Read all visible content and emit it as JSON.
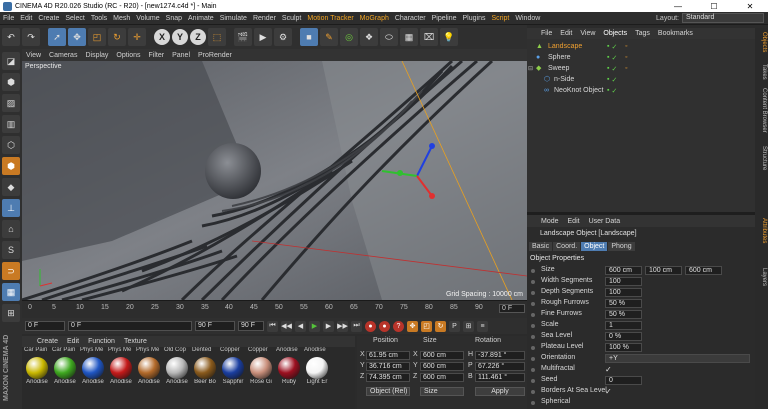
{
  "window": {
    "title": "CINEMA 4D R20.026 Studio (RC - R20) - [new1274.c4d *] - Main",
    "minimize": "—",
    "maximize": "☐",
    "close": "✕"
  },
  "menubar": {
    "items": [
      "File",
      "Edit",
      "Create",
      "Select",
      "Tools",
      "Mesh",
      "Volume",
      "Snap",
      "Animate",
      "Simulate",
      "Render",
      "Sculpt",
      "Motion Tracker",
      "MoGraph",
      "Character",
      "Pipeline",
      "Plugins",
      "Script",
      "Window"
    ],
    "layout_label": "Layout:",
    "layout_value": "Standard"
  },
  "viewport": {
    "menu": [
      "View",
      "Cameras",
      "Display",
      "Options",
      "Filter",
      "Panel",
      "ProRender"
    ],
    "camera_label": "Perspective",
    "grid_spacing": "Grid Spacing : 10000 cm"
  },
  "timeline": {
    "ticks": [
      "0",
      "5",
      "10",
      "15",
      "20",
      "25",
      "30",
      "35",
      "40",
      "45",
      "50",
      "55",
      "60",
      "65",
      "70",
      "75",
      "80",
      "85",
      "90"
    ],
    "end_field": "0 F",
    "current": "0 F",
    "start": "0 F",
    "range_end": "90 F",
    "max": "90 F"
  },
  "material_manager": {
    "menu": [
      "Create",
      "Edit",
      "Function",
      "Texture"
    ],
    "top_labels": [
      "Car Pain",
      "Car Pain",
      "Phys Me",
      "Phys Me",
      "Phys Me",
      "Old Cop",
      "Dented",
      "Copper",
      "Copper",
      "Anodise",
      "Anodise"
    ],
    "materials": [
      {
        "label": "Anodise",
        "color": "#c9b800"
      },
      {
        "label": "Anodise",
        "color": "#3ea81f"
      },
      {
        "label": "Anodise",
        "color": "#1f56c4"
      },
      {
        "label": "Anodise",
        "color": "#c41a1a"
      },
      {
        "label": "Anodise",
        "color": "#b36a2a"
      },
      {
        "label": "Anodise",
        "color": "#b8b8b8"
      },
      {
        "label": "Beer Bo",
        "color": "#8a5a1c"
      },
      {
        "label": "Sapphir",
        "color": "#1a3ea0"
      },
      {
        "label": "Rose Gi",
        "color": "#c98f7b"
      },
      {
        "label": "Ruby",
        "color": "#9c1020"
      },
      {
        "label": "Light Er",
        "color": "#f4f4f4"
      }
    ]
  },
  "coordinates": {
    "headers": [
      "Position",
      "Size",
      "Rotation"
    ],
    "rows": [
      {
        "axis": "X",
        "pos": "61.95 cm",
        "saxis": "X",
        "size": "600 cm",
        "raxis": "H",
        "rot": "-37.891 °"
      },
      {
        "axis": "Y",
        "pos": "36.716 cm",
        "saxis": "Y",
        "size": "600 cm",
        "raxis": "P",
        "rot": "67.226 °"
      },
      {
        "axis": "Z",
        "pos": "74.395 cm",
        "saxis": "Z",
        "size": "600 cm",
        "raxis": "B",
        "rot": "111.461 °"
      }
    ],
    "mode": "Object (Rel)",
    "size_mode": "Size",
    "apply": "Apply"
  },
  "object_manager": {
    "menu": [
      "File",
      "Edit",
      "View",
      "Objects",
      "Tags",
      "Bookmarks"
    ],
    "objects": [
      {
        "name": "Landscape",
        "selected": true,
        "icon": "landscape-icon",
        "glyph": "▲"
      },
      {
        "name": "Sphere",
        "selected": false,
        "icon": "sphere-icon",
        "glyph": "●"
      },
      {
        "name": "Sweep",
        "selected": false,
        "icon": "sweep-icon",
        "glyph": "◆"
      },
      {
        "name": "n-Side",
        "selected": false,
        "icon": "nside-icon",
        "glyph": "⬡"
      },
      {
        "name": "NeoKnot Object",
        "selected": false,
        "icon": "knot-icon",
        "glyph": "∞"
      }
    ]
  },
  "attribute_manager": {
    "menu": [
      "Mode",
      "Edit",
      "User Data"
    ],
    "title": "Landscape Object [Landscape]",
    "tabs": [
      "Basic",
      "Coord.",
      "Object",
      "Phong"
    ],
    "active_tab": "Object",
    "section": "Object Properties",
    "rows": [
      {
        "label": "Size",
        "values": [
          "600 cm",
          "100 cm",
          "600 cm"
        ]
      },
      {
        "label": "Width Segments",
        "values": [
          "100"
        ]
      },
      {
        "label": "Depth Segments",
        "values": [
          "100"
        ]
      },
      {
        "label": "Rough Furrows",
        "values": [
          "50 %"
        ]
      },
      {
        "label": "Fine Furrows",
        "values": [
          "50 %"
        ]
      },
      {
        "label": "Scale",
        "values": [
          "1"
        ]
      },
      {
        "label": "Sea Level",
        "values": [
          "0 %"
        ]
      },
      {
        "label": "Plateau Level",
        "values": [
          "100 %"
        ]
      },
      {
        "label": "Orientation",
        "values": [
          "+Y"
        ]
      },
      {
        "label": "Multifractal",
        "check": "✓"
      },
      {
        "label": "Seed",
        "values": [
          "0"
        ]
      },
      {
        "label": "Borders At Sea Level",
        "check": "✓"
      },
      {
        "label": "Spherical",
        "check": ""
      }
    ]
  },
  "right_tabs": [
    "Objects",
    "Takes",
    "Content Browser",
    "Structure",
    "Attributes",
    "Layers"
  ],
  "colors": {
    "accent": "#4e7cb1",
    "highlight": "#f0a030"
  }
}
